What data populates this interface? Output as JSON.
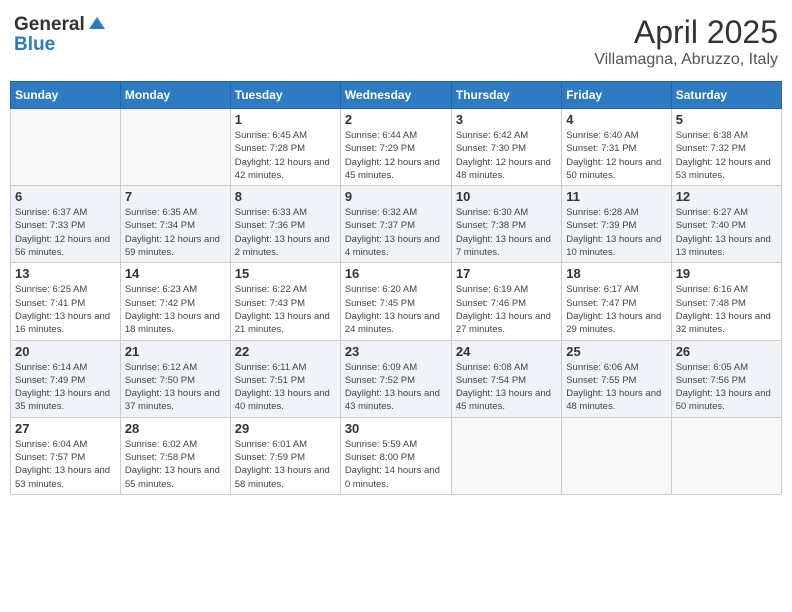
{
  "header": {
    "logo_general": "General",
    "logo_blue": "Blue",
    "month": "April 2025",
    "location": "Villamagna, Abruzzo, Italy"
  },
  "weekdays": [
    "Sunday",
    "Monday",
    "Tuesday",
    "Wednesday",
    "Thursday",
    "Friday",
    "Saturday"
  ],
  "weeks": [
    [
      {
        "day": "",
        "info": ""
      },
      {
        "day": "",
        "info": ""
      },
      {
        "day": "1",
        "info": "Sunrise: 6:45 AM\nSunset: 7:28 PM\nDaylight: 12 hours and 42 minutes."
      },
      {
        "day": "2",
        "info": "Sunrise: 6:44 AM\nSunset: 7:29 PM\nDaylight: 12 hours and 45 minutes."
      },
      {
        "day": "3",
        "info": "Sunrise: 6:42 AM\nSunset: 7:30 PM\nDaylight: 12 hours and 48 minutes."
      },
      {
        "day": "4",
        "info": "Sunrise: 6:40 AM\nSunset: 7:31 PM\nDaylight: 12 hours and 50 minutes."
      },
      {
        "day": "5",
        "info": "Sunrise: 6:38 AM\nSunset: 7:32 PM\nDaylight: 12 hours and 53 minutes."
      }
    ],
    [
      {
        "day": "6",
        "info": "Sunrise: 6:37 AM\nSunset: 7:33 PM\nDaylight: 12 hours and 56 minutes."
      },
      {
        "day": "7",
        "info": "Sunrise: 6:35 AM\nSunset: 7:34 PM\nDaylight: 12 hours and 59 minutes."
      },
      {
        "day": "8",
        "info": "Sunrise: 6:33 AM\nSunset: 7:36 PM\nDaylight: 13 hours and 2 minutes."
      },
      {
        "day": "9",
        "info": "Sunrise: 6:32 AM\nSunset: 7:37 PM\nDaylight: 13 hours and 4 minutes."
      },
      {
        "day": "10",
        "info": "Sunrise: 6:30 AM\nSunset: 7:38 PM\nDaylight: 13 hours and 7 minutes."
      },
      {
        "day": "11",
        "info": "Sunrise: 6:28 AM\nSunset: 7:39 PM\nDaylight: 13 hours and 10 minutes."
      },
      {
        "day": "12",
        "info": "Sunrise: 6:27 AM\nSunset: 7:40 PM\nDaylight: 13 hours and 13 minutes."
      }
    ],
    [
      {
        "day": "13",
        "info": "Sunrise: 6:25 AM\nSunset: 7:41 PM\nDaylight: 13 hours and 16 minutes."
      },
      {
        "day": "14",
        "info": "Sunrise: 6:23 AM\nSunset: 7:42 PM\nDaylight: 13 hours and 18 minutes."
      },
      {
        "day": "15",
        "info": "Sunrise: 6:22 AM\nSunset: 7:43 PM\nDaylight: 13 hours and 21 minutes."
      },
      {
        "day": "16",
        "info": "Sunrise: 6:20 AM\nSunset: 7:45 PM\nDaylight: 13 hours and 24 minutes."
      },
      {
        "day": "17",
        "info": "Sunrise: 6:19 AM\nSunset: 7:46 PM\nDaylight: 13 hours and 27 minutes."
      },
      {
        "day": "18",
        "info": "Sunrise: 6:17 AM\nSunset: 7:47 PM\nDaylight: 13 hours and 29 minutes."
      },
      {
        "day": "19",
        "info": "Sunrise: 6:16 AM\nSunset: 7:48 PM\nDaylight: 13 hours and 32 minutes."
      }
    ],
    [
      {
        "day": "20",
        "info": "Sunrise: 6:14 AM\nSunset: 7:49 PM\nDaylight: 13 hours and 35 minutes."
      },
      {
        "day": "21",
        "info": "Sunrise: 6:12 AM\nSunset: 7:50 PM\nDaylight: 13 hours and 37 minutes."
      },
      {
        "day": "22",
        "info": "Sunrise: 6:11 AM\nSunset: 7:51 PM\nDaylight: 13 hours and 40 minutes."
      },
      {
        "day": "23",
        "info": "Sunrise: 6:09 AM\nSunset: 7:52 PM\nDaylight: 13 hours and 43 minutes."
      },
      {
        "day": "24",
        "info": "Sunrise: 6:08 AM\nSunset: 7:54 PM\nDaylight: 13 hours and 45 minutes."
      },
      {
        "day": "25",
        "info": "Sunrise: 6:06 AM\nSunset: 7:55 PM\nDaylight: 13 hours and 48 minutes."
      },
      {
        "day": "26",
        "info": "Sunrise: 6:05 AM\nSunset: 7:56 PM\nDaylight: 13 hours and 50 minutes."
      }
    ],
    [
      {
        "day": "27",
        "info": "Sunrise: 6:04 AM\nSunset: 7:57 PM\nDaylight: 13 hours and 53 minutes."
      },
      {
        "day": "28",
        "info": "Sunrise: 6:02 AM\nSunset: 7:58 PM\nDaylight: 13 hours and 55 minutes."
      },
      {
        "day": "29",
        "info": "Sunrise: 6:01 AM\nSunset: 7:59 PM\nDaylight: 13 hours and 58 minutes."
      },
      {
        "day": "30",
        "info": "Sunrise: 5:59 AM\nSunset: 8:00 PM\nDaylight: 14 hours and 0 minutes."
      },
      {
        "day": "",
        "info": ""
      },
      {
        "day": "",
        "info": ""
      },
      {
        "day": "",
        "info": ""
      }
    ]
  ]
}
